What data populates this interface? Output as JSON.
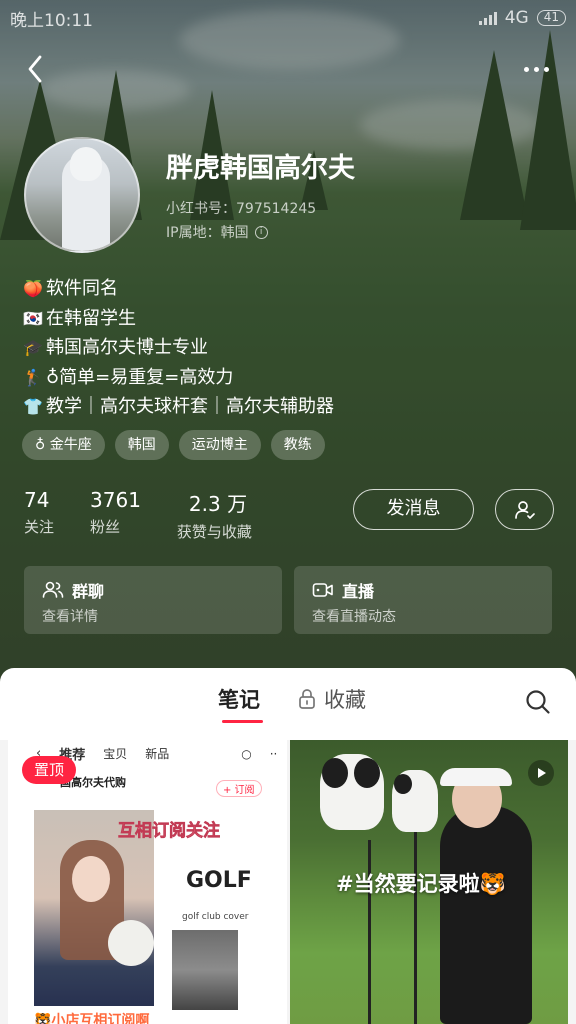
{
  "status_bar": {
    "time": "晚上10:11",
    "network": "4G",
    "battery": "41"
  },
  "profile": {
    "name": "胖虎韩国高尔夫",
    "red_id": "小红书号：797514245",
    "ip_location": "IP属地：韩国",
    "bio": [
      {
        "icon": "peach-emoji-icon",
        "emoji": "🍑",
        "text": "软件同名"
      },
      {
        "icon": "korea-flag-icon",
        "emoji": "🇰🇷",
        "text": "在韩留学生"
      },
      {
        "icon": "graduation-cap-icon",
        "emoji": "🎓",
        "text": "韩国高尔夫博士专业"
      },
      {
        "icon": "golfer-emoji-icon",
        "emoji": "🏌",
        "text": "♁简单=易重复=高效力"
      },
      {
        "icon": "shirt-emoji-icon",
        "emoji": "👕",
        "text": "教学｜高尔夫球杆套｜高尔夫辅助器"
      }
    ],
    "tags": [
      "♁ 金牛座",
      "韩国",
      "运动博主",
      "教练"
    ]
  },
  "stats": [
    {
      "value": "74",
      "label": "关注"
    },
    {
      "value": "3761",
      "label": "粉丝"
    },
    {
      "value": "2.3 万",
      "label": "获赞与收藏"
    }
  ],
  "actions": {
    "message": "发消息",
    "follow_icon": "user-check-icon"
  },
  "cards": [
    {
      "icon": "group-icon",
      "title": "群聊",
      "subtitle": "查看详情"
    },
    {
      "icon": "live-camera-icon",
      "title": "直播",
      "subtitle": "查看直播动态"
    }
  ],
  "tabs": {
    "notes": "笔记",
    "favorites": "收藏",
    "favorites_icon": "lock-icon"
  },
  "notes": {
    "left": {
      "pin_label": "置顶",
      "mini_tabs": [
        "推荐",
        "宝贝",
        "新品"
      ],
      "shop_name": "国高尔夫代购",
      "subscribe": "+ 订阅",
      "caption": "互相订阅关注",
      "golf_title": "GOLF",
      "golf_subtitle": "golf club cover",
      "footer": "🐯小店互相订阅啊"
    },
    "right": {
      "caption": "#当然要记录啦🐯",
      "video_icon": "play-icon"
    }
  },
  "colors": {
    "accent": "#ff2442",
    "panel_bg": "#ffffff"
  }
}
